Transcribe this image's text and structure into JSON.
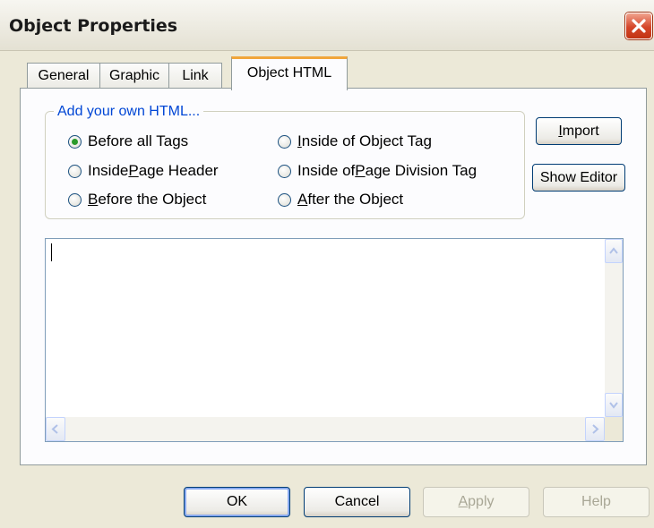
{
  "window": {
    "title": "Object Properties",
    "close_icon": "close-icon"
  },
  "tabs": [
    {
      "label": "General",
      "active": false
    },
    {
      "label": "Graphic",
      "active": false
    },
    {
      "label": "Link",
      "active": false
    },
    {
      "label": "Object HTML",
      "active": true
    }
  ],
  "group": {
    "legend": "Add your own HTML...",
    "options": [
      {
        "pre": "Before all Tags",
        "ul": "",
        "post": "",
        "checked": true
      },
      {
        "pre": "",
        "ul": "I",
        "post": "nside of Object Tag",
        "checked": false
      },
      {
        "pre": "Inside ",
        "ul": "P",
        "post": "age Header",
        "checked": false
      },
      {
        "pre": "Inside of ",
        "ul": "P",
        "post": "age Division Tag",
        "checked": false
      },
      {
        "pre": "",
        "ul": "B",
        "post": "efore the Object",
        "checked": false
      },
      {
        "pre": "",
        "ul": "A",
        "post": "fter the Object",
        "checked": false
      }
    ]
  },
  "side_buttons": {
    "import": {
      "ul": "I",
      "post": "mport"
    },
    "show_editor": "Show Editor"
  },
  "editor": {
    "value": ""
  },
  "footer": {
    "ok": "OK",
    "cancel": "Cancel",
    "apply": {
      "ul": "A",
      "post": "pply",
      "disabled": true
    },
    "help": {
      "label": "Help",
      "disabled": true
    }
  },
  "colors": {
    "accent_tab": "#f1a63b",
    "legend": "#0046d5",
    "close": "#d5462a"
  }
}
